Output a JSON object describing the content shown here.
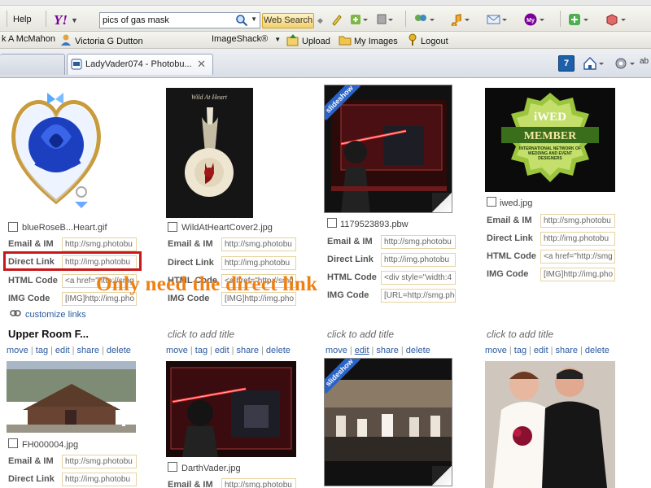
{
  "browser": {
    "menu_help": "Help",
    "search": {
      "value": "pics of gas mask",
      "button": "Web Search"
    },
    "bookmarks": {
      "item1": "k A McMahon",
      "item2": "Victoria G Dutton",
      "imageshack": "ImageShack®",
      "upload": "Upload",
      "my_images": "My Images",
      "logout": "Logout"
    },
    "tab_active": "LadyVader074 - Photobu...",
    "tab_close": "✕",
    "page_number": "7"
  },
  "row1": [
    {
      "filename": "blueRoseB...Heart.gif",
      "fields": [
        {
          "label": "Email & IM",
          "value": "http://smg.photobu"
        },
        {
          "label": "Direct Link",
          "value": "http://img.photobu"
        },
        {
          "label": "HTML Code",
          "value": "<a href=\"http://smg"
        },
        {
          "label": "IMG Code",
          "value": "[IMG]http://img.pho"
        }
      ]
    },
    {
      "filename": "WildAtHeartCover2.jpg",
      "fields": [
        {
          "label": "Email & IM",
          "value": "http://smg.photobu"
        },
        {
          "label": "Direct Link",
          "value": "http://img.photobu"
        },
        {
          "label": "HTML Code",
          "value": "<a href=\"http://smg"
        },
        {
          "label": "IMG Code",
          "value": "[IMG]http://img.pho"
        }
      ]
    },
    {
      "filename": "1179523893.pbw",
      "fields": [
        {
          "label": "Email & IM",
          "value": "http://smg.photobu"
        },
        {
          "label": "Direct Link",
          "value": "http://img.photobu"
        },
        {
          "label": "HTML Code",
          "value": "<div style=\"width:4"
        },
        {
          "label": "IMG Code",
          "value": "[URL=http://smg.pho"
        }
      ]
    },
    {
      "filename": "iwed.jpg",
      "fields": [
        {
          "label": "Email & IM",
          "value": "http://smg.photobu"
        },
        {
          "label": "Direct Link",
          "value": "http://img.photobu"
        },
        {
          "label": "HTML Code",
          "value": "<a href=\"http://smg"
        },
        {
          "label": "IMG Code",
          "value": "[IMG]http://img.pho"
        }
      ]
    }
  ],
  "thumb_text": {
    "wild_title": "Wild At Heart",
    "slideshow": "slideshow",
    "iwed_top": "iWED",
    "iwed_mid": "MEMBER",
    "iwed_bottom": "INTERNATIONAL NETWORK OF WEDDING AND EVENT DESIGNERS"
  },
  "customize_links": "customize links",
  "annotation": "Only need the direct link",
  "row2": {
    "album_title": "Upper Room F...",
    "add_title": "click to add title",
    "actions": [
      "move",
      "tag",
      "edit",
      "share",
      "delete"
    ],
    "files": [
      "FH000004.jpg",
      "DarthVader.jpg"
    ],
    "field_labels": [
      "Email & IM",
      "Direct Link"
    ],
    "field_values": [
      "http://smg.photobu",
      "http://img.photobu"
    ]
  },
  "colors": {
    "link_blue": "#2a5aa0",
    "annotation_orange": "#f07f12",
    "highlight_red": "#c8181a",
    "field_border": "#e6d3a3"
  }
}
